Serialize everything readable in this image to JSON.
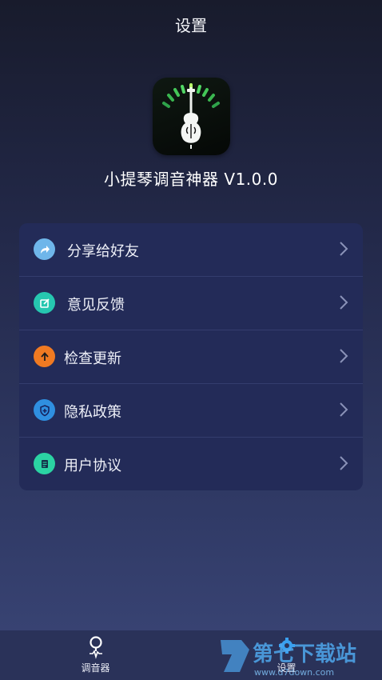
{
  "header": {
    "title": "设置"
  },
  "app": {
    "name": "小提琴调音神器 V1.0.0",
    "icon": "violin-tuner-icon"
  },
  "menu": {
    "items": [
      {
        "label": "分享给好友",
        "icon": "share-icon",
        "color": "#6fb6ea"
      },
      {
        "label": "意见反馈",
        "icon": "feedback-icon",
        "color": "#26c7b0"
      },
      {
        "label": "检查更新",
        "icon": "update-arrow-icon",
        "color": "#f07a22"
      },
      {
        "label": "隐私政策",
        "icon": "privacy-shield-icon",
        "color": "#2f8fe0"
      },
      {
        "label": "用户协议",
        "icon": "agreement-doc-icon",
        "color": "#2bd3a3"
      }
    ]
  },
  "tabbar": {
    "tabs": [
      {
        "label": "调音器",
        "icon": "tuner-pin-icon"
      },
      {
        "label": "设置",
        "icon": "gear-icon"
      }
    ]
  },
  "watermark": {
    "brand": "第七下载站",
    "url": "www.d7down.com"
  }
}
